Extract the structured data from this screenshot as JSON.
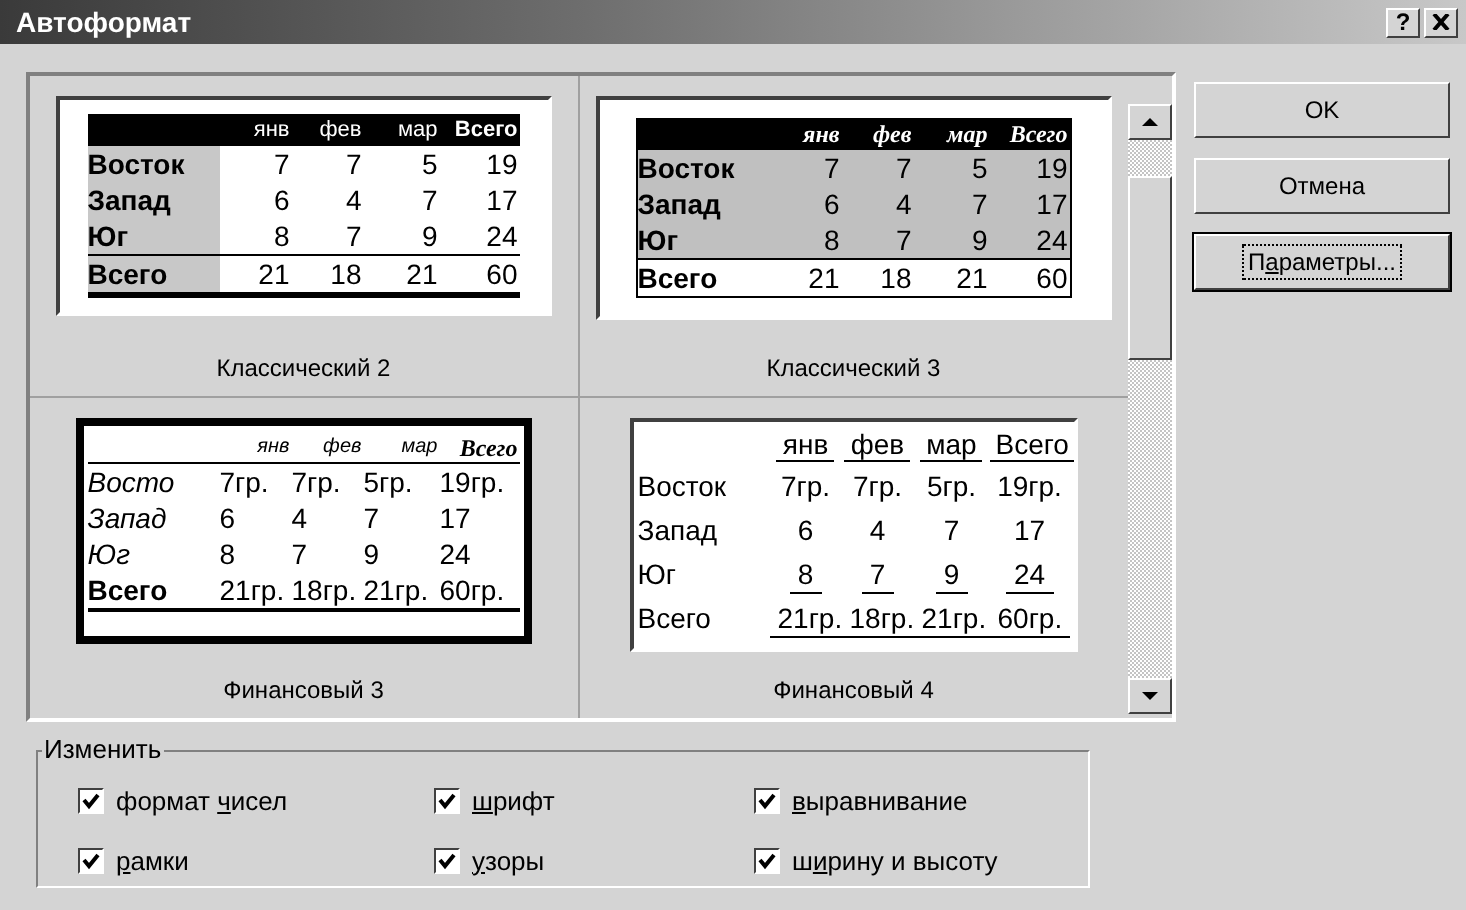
{
  "window": {
    "title": "Автоформат",
    "help": "?"
  },
  "previews": [
    {
      "kind": "classic2",
      "caption": "Классический 2",
      "selected": false,
      "columns": [
        "янв",
        "фев",
        "мар",
        "Всего"
      ],
      "rows": [
        {
          "label": "Восток",
          "cells": [
            "7",
            "7",
            "5",
            "19"
          ]
        },
        {
          "label": "Запад",
          "cells": [
            "6",
            "4",
            "7",
            "17"
          ]
        },
        {
          "label": "Юг",
          "cells": [
            "8",
            "7",
            "9",
            "24"
          ]
        },
        {
          "label": "Всего",
          "cells": [
            "21",
            "18",
            "21",
            "60"
          ]
        }
      ]
    },
    {
      "kind": "classic3",
      "caption": "Классический 3",
      "selected": false,
      "columns": [
        "янв",
        "фев",
        "мар",
        "Всего"
      ],
      "rows": [
        {
          "label": "Восток",
          "cells": [
            "7",
            "7",
            "5",
            "19"
          ]
        },
        {
          "label": "Запад",
          "cells": [
            "6",
            "4",
            "7",
            "17"
          ]
        },
        {
          "label": "Юг",
          "cells": [
            "8",
            "7",
            "9",
            "24"
          ]
        },
        {
          "label": "Всего",
          "cells": [
            "21",
            "18",
            "21",
            "60"
          ]
        }
      ]
    },
    {
      "kind": "financial3",
      "caption": "Финансовый 3",
      "selected": true,
      "columns": [
        "янв",
        "фев",
        "мар",
        "Всего"
      ],
      "rows": [
        {
          "label": "Восто",
          "cells": [
            "7гр.",
            "7гр.",
            "5гр.",
            "19гр."
          ]
        },
        {
          "label": "Запад",
          "cells": [
            "6",
            "4",
            "7",
            "17"
          ]
        },
        {
          "label": "Юг",
          "cells": [
            "8",
            "7",
            "9",
            "24"
          ]
        },
        {
          "label": "Всего",
          "cells": [
            "21гр.",
            "18гр.",
            "21гр.",
            "60гр."
          ]
        }
      ]
    },
    {
      "kind": "financial4",
      "caption": "Финансовый 4",
      "selected": false,
      "columns": [
        "янв",
        "фев",
        "мар",
        "Всего"
      ],
      "rows": [
        {
          "label": "Восток",
          "cells": [
            "7гр.",
            "7гр.",
            "5гр.",
            "19гр."
          ]
        },
        {
          "label": "Запад",
          "cells": [
            "6",
            "4",
            "7",
            "17"
          ]
        },
        {
          "label": "Юг",
          "cells": [
            "8",
            "7",
            "9",
            "24"
          ]
        },
        {
          "label": "Всего",
          "cells": [
            "21гр.",
            "18гр.",
            "21гр.",
            "60гр."
          ]
        }
      ]
    }
  ],
  "buttons": [
    {
      "label": {
        "pre": "OK"
      },
      "focused": false
    },
    {
      "label": {
        "pre": "Отмена"
      },
      "focused": false
    },
    {
      "label": {
        "pre": "П",
        "key": "а",
        "post": "раметры..."
      },
      "focused": true
    }
  ],
  "apply_group": {
    "title": "Изменить",
    "options": [
      {
        "label": {
          "pre": "формат ",
          "key": "ч",
          "post": "исел"
        },
        "checked": true
      },
      {
        "label": {
          "key": "ш",
          "post": "рифт"
        },
        "checked": true
      },
      {
        "label": {
          "key": "в",
          "post": "ыравнивание"
        },
        "checked": true
      },
      {
        "label": {
          "key": "р",
          "post": "амки"
        },
        "checked": true
      },
      {
        "label": {
          "key": "у",
          "post": "зоры"
        },
        "checked": true
      },
      {
        "label": {
          "pre": "ш",
          "key": "и",
          "post": "рину и высоту"
        },
        "checked": true
      }
    ]
  }
}
